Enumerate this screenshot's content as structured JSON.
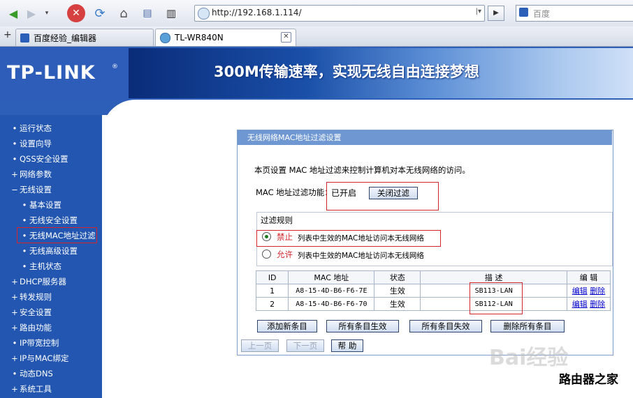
{
  "browser": {
    "url": "http://192.168.1.114/",
    "search_placeholder": "百度",
    "tabs": [
      {
        "label": "百度经验_编辑器"
      },
      {
        "label": "TL-WR840N"
      }
    ]
  },
  "header": {
    "logo": "TP-LINK",
    "banner_text": "300M传输速率，实现无线自由连接梦想"
  },
  "sidebar": {
    "items": [
      {
        "label": "运行状态",
        "bullet": "•"
      },
      {
        "label": "设置向导",
        "bullet": "•"
      },
      {
        "label": "QSS安全设置",
        "bullet": "•"
      },
      {
        "label": "网络参数",
        "bullet": "+"
      },
      {
        "label": "无线设置",
        "bullet": "−"
      },
      {
        "label": "基本设置",
        "bullet": "•"
      },
      {
        "label": "无线安全设置",
        "bullet": "•"
      },
      {
        "label": "无线MAC地址过滤",
        "bullet": "•"
      },
      {
        "label": "无线高级设置",
        "bullet": "•"
      },
      {
        "label": "主机状态",
        "bullet": "•"
      },
      {
        "label": "DHCP服务器",
        "bullet": "+"
      },
      {
        "label": "转发规则",
        "bullet": "+"
      },
      {
        "label": "安全设置",
        "bullet": "+"
      },
      {
        "label": "路由功能",
        "bullet": "+"
      },
      {
        "label": "IP带宽控制",
        "bullet": "•"
      },
      {
        "label": "IP与MAC绑定",
        "bullet": "+"
      },
      {
        "label": "动态DNS",
        "bullet": "•"
      },
      {
        "label": "系统工具",
        "bullet": "+"
      }
    ]
  },
  "panel": {
    "title": "无线网络MAC地址过滤设置",
    "description": "本页设置 MAC 地址过滤来控制计算机对本无线网络的访问。",
    "filter_label": "MAC 地址过滤功能：",
    "filter_status": "已开启",
    "close_filter_button": "关闭过滤",
    "rules_title": "过滤规则",
    "rule_deny_keyword": "禁止",
    "rule_deny_text": "列表中生效的MAC地址访问本无线网络",
    "rule_allow_keyword": "允许",
    "rule_allow_text": "列表中生效的MAC地址访问本无线网络",
    "table": {
      "headers": [
        "ID",
        "MAC 地址",
        "状态",
        "描 述",
        "编 辑"
      ],
      "rows": [
        {
          "id": "1",
          "mac": "A8-15-4D-B6-F6-7E",
          "status": "生效",
          "desc": "SB113-LAN",
          "edit": "编辑",
          "delete": "删除"
        },
        {
          "id": "2",
          "mac": "A8-15-4D-B6-F6-70",
          "status": "生效",
          "desc": "SB112-LAN",
          "edit": "编辑",
          "delete": "删除"
        }
      ]
    },
    "buttons": {
      "add": "添加新条目",
      "enable_all": "所有条目生效",
      "disable_all": "所有条目失效",
      "delete_all": "删除所有条目",
      "prev": "上一页",
      "next": "下一页",
      "help": "帮 助"
    }
  },
  "watermark": {
    "baidu": "Bai经验",
    "site": "路由器之家"
  },
  "colors": {
    "sidebar_bg": "#2256b0",
    "panel_title_bg": "#6f98d3",
    "red_keyword": "#d2262c",
    "link_blue": "#0000cc"
  }
}
